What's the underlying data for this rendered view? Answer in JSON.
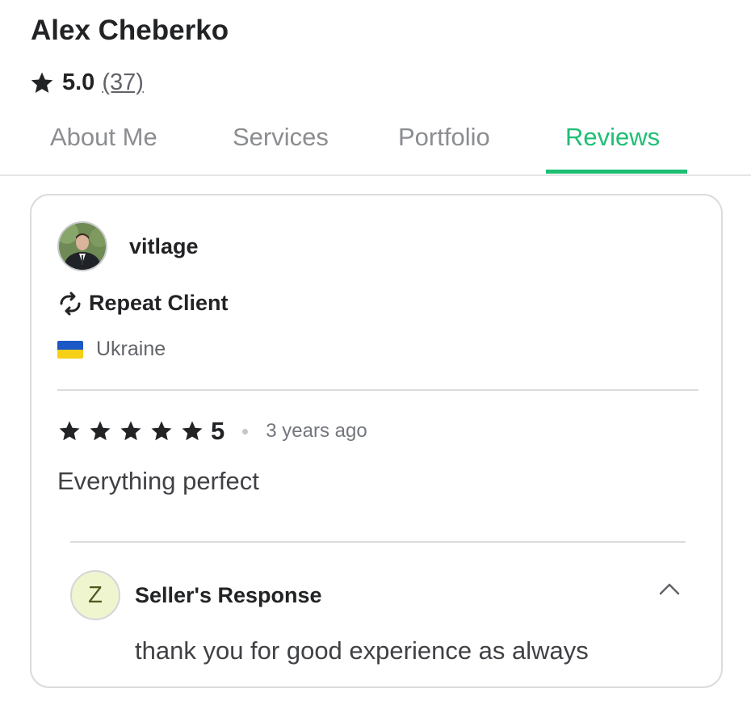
{
  "seller": {
    "name": "Alex Cheberko",
    "rating": "5.0",
    "review_count": "(37)"
  },
  "tabs": [
    {
      "label": "About Me",
      "active": false
    },
    {
      "label": "Services",
      "active": false
    },
    {
      "label": "Portfolio",
      "active": false
    },
    {
      "label": "Reviews",
      "active": true
    }
  ],
  "review": {
    "reviewer": "vitlage",
    "badge": "Repeat Client",
    "country": "Ukraine",
    "stars": 5,
    "score": "5",
    "time_ago": "3 years ago",
    "text": "Everything perfect",
    "response": {
      "initial": "Z",
      "title": "Seller's Response",
      "text": "thank you for good experience as always"
    }
  },
  "colors": {
    "accent": "#1dbf73",
    "text": "#222325",
    "muted": "#62646a"
  },
  "icons": [
    "star-icon",
    "repeat-icon",
    "ukraine-flag-icon",
    "chevron-up-icon"
  ]
}
